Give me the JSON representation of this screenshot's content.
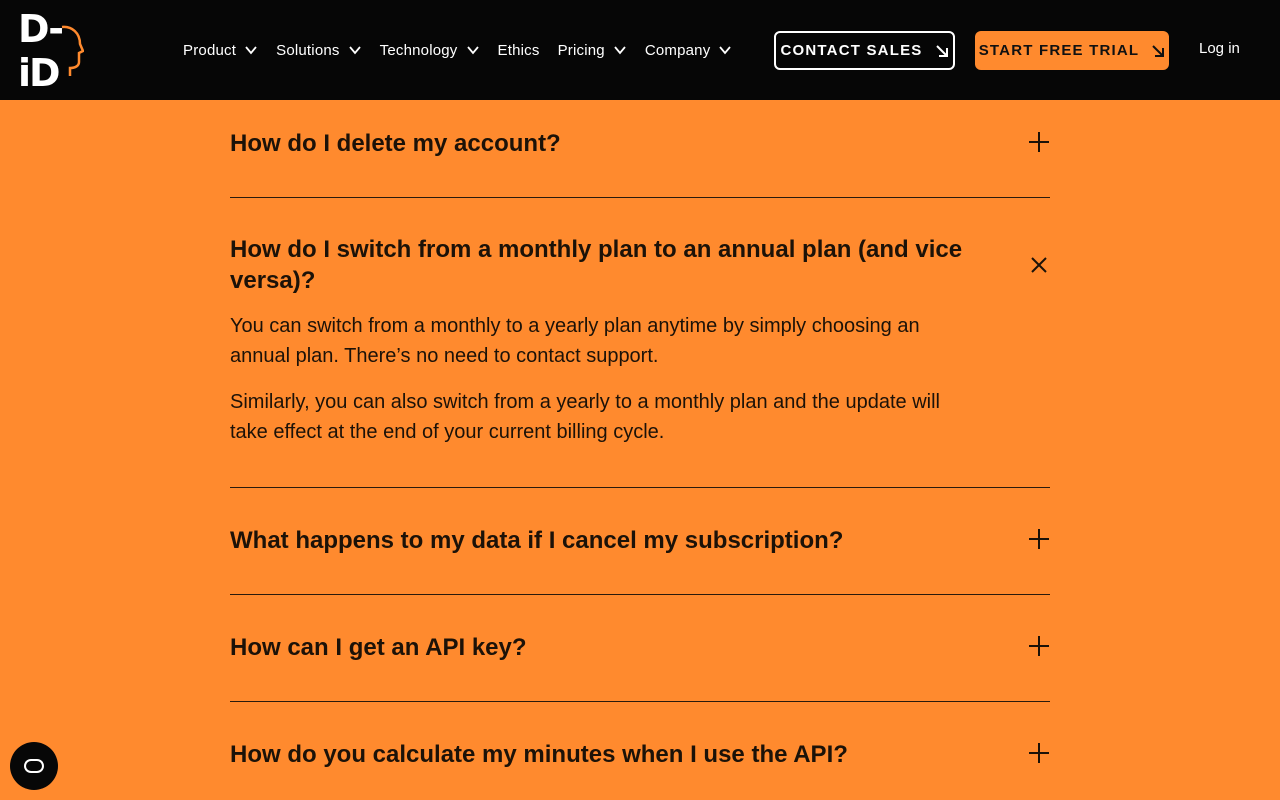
{
  "header": {
    "logo_text": "D-iD",
    "nav": [
      {
        "label": "Product",
        "dropdown": true
      },
      {
        "label": "Solutions",
        "dropdown": true
      },
      {
        "label": "Technology",
        "dropdown": true
      },
      {
        "label": "Ethics",
        "dropdown": false
      },
      {
        "label": "Pricing",
        "dropdown": true
      },
      {
        "label": "Company",
        "dropdown": true
      }
    ],
    "contact_sales": "CONTACT SALES",
    "start_trial": "START FREE TRIAL",
    "login": "Log in"
  },
  "faq": [
    {
      "question": "How do I delete my account?",
      "expanded": false
    },
    {
      "question": "How do I switch from a monthly plan to an annual plan (and vice versa)?",
      "expanded": true,
      "answer": [
        "You can switch from a monthly to a yearly plan anytime by simply choosing an annual plan. There’s no need to contact support.",
        "Similarly, you can also switch from a yearly to a monthly plan and the update will take effect at the end of your current billing cycle."
      ]
    },
    {
      "question": "What happens to my data if I cancel my subscription?",
      "expanded": false
    },
    {
      "question": "How can I get an API key?",
      "expanded": false
    },
    {
      "question": "How do you calculate my minutes when I use the API?",
      "expanded": false
    }
  ],
  "colors": {
    "background": "#ff8a2e",
    "header": "#060606",
    "accent": "#ff8a2e"
  },
  "icons": {
    "expand": "plus-icon",
    "collapse": "close-icon",
    "cookie": "cookie-settings-icon"
  }
}
